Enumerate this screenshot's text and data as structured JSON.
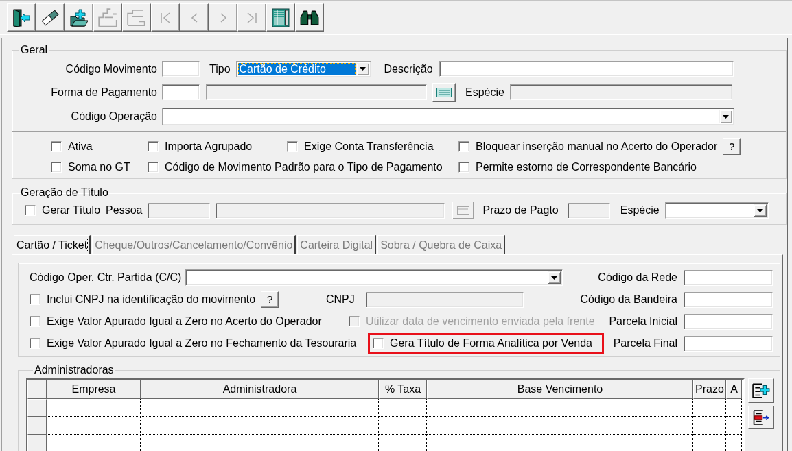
{
  "toolbar": [
    {
      "kind": "exit",
      "disabled": false
    },
    {
      "kind": "clear",
      "disabled": false
    },
    {
      "kind": "new",
      "disabled": false
    },
    {
      "kind": "save",
      "disabled": true
    },
    {
      "kind": "discard",
      "disabled": true
    },
    {
      "kind": "first",
      "disabled": true
    },
    {
      "kind": "prior",
      "disabled": true
    },
    {
      "kind": "next",
      "disabled": true
    },
    {
      "kind": "last",
      "disabled": true
    },
    {
      "kind": "grid",
      "disabled": false
    },
    {
      "kind": "find",
      "disabled": false
    }
  ],
  "general": {
    "title": "Geral",
    "movement_code": {
      "label": "Código Movimento"
    },
    "type": {
      "label": "Tipo",
      "value": "Cartão de Crédito"
    },
    "description": {
      "label": "Descrição"
    },
    "payment_method": {
      "label": "Forma de Pagamento",
      "name_disabled": true
    },
    "species": {
      "label": "Espécie",
      "disabled": true
    },
    "operation_code": {
      "label": "Código Operação"
    },
    "option_rows": [
      [
        {
          "label": "Ativa",
          "checked": false
        },
        {
          "label": "Importa Agrupado",
          "checked": false
        },
        {
          "label": "Exige Conta Transferência",
          "checked": false
        },
        {
          "label": "Bloquear inserção manual no Acerto do Operador",
          "checked": false,
          "help_button": "?"
        }
      ],
      [
        {
          "label": "Soma no GT",
          "checked": false
        },
        {
          "label": "Código de Movimento Padrão para o Tipo de Pagamento",
          "checked": false
        },
        {
          "label": "Permite estorno de Correspondente Bancário",
          "checked": false
        }
      ]
    ]
  },
  "title_generation": {
    "title": "Geração de Título",
    "generate": {
      "label": "Gerar Título",
      "checked": false
    },
    "person": {
      "label": "Pessoa",
      "disabled": true
    },
    "payment_term": {
      "label": "Prazo de Pagto",
      "disabled": true
    },
    "species": {
      "label": "Espécie"
    }
  },
  "tabs": [
    {
      "label": "Cartão / Ticket",
      "selected": true
    },
    {
      "label": "Cheque/Outros/Cancelamento/Convênio",
      "selected": false
    },
    {
      "label": "Carteira Digital",
      "selected": false
    },
    {
      "label": "Sobra / Quebra de Caixa",
      "selected": false
    }
  ],
  "card_tab": {
    "counter_operation": {
      "label": "Código Oper. Ctr. Partida (C/C)"
    },
    "include_cnpj": {
      "label": "Inclui CNPJ na identificação do movimento",
      "checked": false,
      "help_button": "?"
    },
    "cnpj": {
      "label": "CNPJ",
      "disabled": true
    },
    "zero_at_operator": {
      "label": "Exige Valor Apurado Igual a Zero no Acerto do Operador",
      "checked": false
    },
    "front_due_date": {
      "label": "Utilizar data de vencimento enviada pela frente",
      "checked": false,
      "disabled": true
    },
    "zero_at_treasury": {
      "label": "Exige Valor Apurado Igual a Zero no Fechamento da Tesouraria",
      "checked": false
    },
    "analytic_title": {
      "label": "Gera Título de Forma Analítica por Venda",
      "checked": false,
      "highlighted": true
    },
    "side_fields": [
      {
        "label": "Código da Rede"
      },
      {
        "label": "Código da Bandeira"
      },
      {
        "label": "Parcela Inicial"
      },
      {
        "label": "Parcela Final"
      }
    ]
  },
  "administrators": {
    "title": "Administradoras",
    "columns": [
      {
        "label": "Empresa"
      },
      {
        "label": "Administradora"
      },
      {
        "label": "% Taxa"
      },
      {
        "label": "Base Vencimento"
      },
      {
        "label": "Prazo"
      },
      {
        "label": "A"
      }
    ]
  }
}
